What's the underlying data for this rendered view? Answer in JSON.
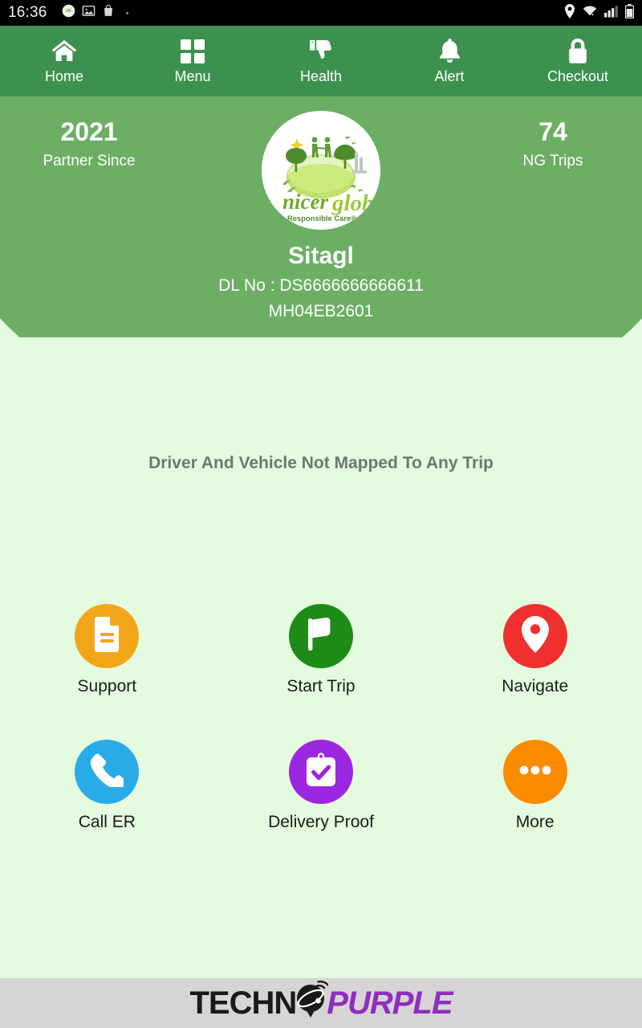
{
  "status_bar": {
    "time": "16:36",
    "left_icons": [
      "android-icon",
      "image-icon",
      "shopping-bag-icon",
      "more-dot-icon"
    ],
    "right_icons": [
      "location-icon",
      "wifi-icon",
      "signal-icon",
      "battery-icon"
    ]
  },
  "top_nav": {
    "items": [
      {
        "label": "Home",
        "icon": "home-icon"
      },
      {
        "label": "Menu",
        "icon": "grid-icon"
      },
      {
        "label": "Health",
        "icon": "thumbs-down-icon"
      },
      {
        "label": "Alert",
        "icon": "bell-icon"
      },
      {
        "label": "Checkout",
        "icon": "lock-icon"
      }
    ]
  },
  "profile": {
    "stat_left_value": "2021",
    "stat_left_label": "Partner Since",
    "stat_right_value": "74",
    "stat_right_label": "NG Trips",
    "driver_name": "Sitagl",
    "dl_no": "DL No : DS6666666666611",
    "vehicle_no": "MH04EB2601",
    "logo_text_1": "nicer",
    "logo_text_2": "globe",
    "logo_tagline": "Responsible Care® Initiative"
  },
  "main": {
    "message": "Driver And Vehicle Not Mapped To Any Trip"
  },
  "actions": [
    {
      "label": "Support",
      "icon": "document-icon",
      "color": "#F2A71B"
    },
    {
      "label": "Start Trip",
      "icon": "flag-icon",
      "color": "#1E8B17"
    },
    {
      "label": "Navigate",
      "icon": "map-pin-icon",
      "color": "#F0302E"
    },
    {
      "label": "Call ER",
      "icon": "phone-icon",
      "color": "#29ABE8"
    },
    {
      "label": "Delivery Proof",
      "icon": "clipboard-check-icon",
      "color": "#9C27E0"
    },
    {
      "label": "More",
      "icon": "ellipsis-icon",
      "color": "#FB8C00"
    }
  ],
  "footer": {
    "brand_part_1": "TECHN",
    "brand_part_2": "PURPLE",
    "brand_mark": "globe-pin-icon"
  },
  "colors": {
    "nav_green": "#3D914F",
    "header_green": "#6CAF64",
    "page_bg": "#E4FBE0",
    "footer_bg": "#D6D4D4",
    "brand_purple": "#8E2FBF"
  }
}
